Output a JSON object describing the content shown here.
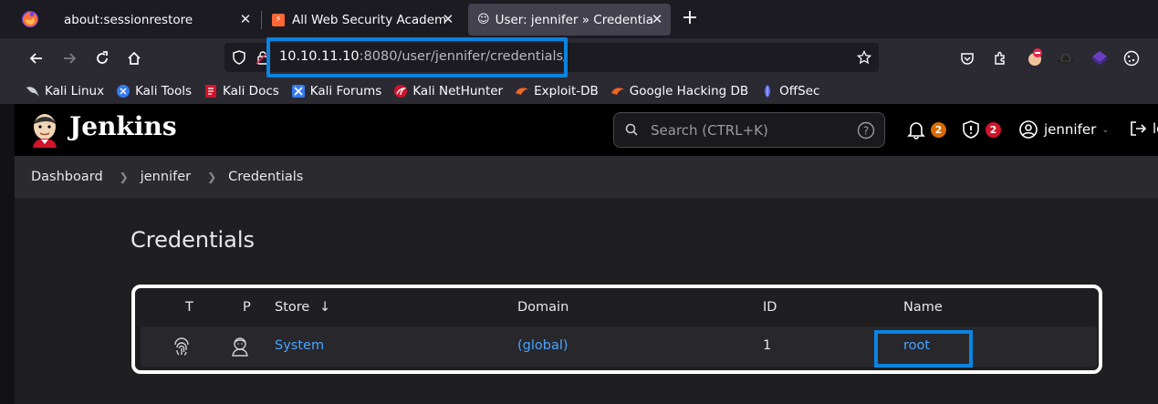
{
  "browser": {
    "tabs": [
      {
        "title": "about:sessionrestore"
      },
      {
        "title": "All Web Security Academy"
      },
      {
        "title": "User: jennifer » Credentials"
      }
    ],
    "url_host": "10.10.11.10",
    "url_rest": ":8080/user/jennifer/credentials/",
    "bookmarks": [
      {
        "label": "Kali Linux",
        "icon": "kali-dragon-icon"
      },
      {
        "label": "Kali Tools",
        "icon": "kali-tools-icon"
      },
      {
        "label": "Kali Docs",
        "icon": "kali-docs-icon"
      },
      {
        "label": "Kali Forums",
        "icon": "kali-forums-icon"
      },
      {
        "label": "Kali NetHunter",
        "icon": "nethunter-icon"
      },
      {
        "label": "Exploit-DB",
        "icon": "exploitdb-icon"
      },
      {
        "label": "Google Hacking DB",
        "icon": "ghdb-icon"
      },
      {
        "label": "OffSec",
        "icon": "offsec-icon"
      }
    ]
  },
  "jenkins": {
    "brand": "Jenkins",
    "search_placeholder": "Search (CTRL+K)",
    "notifications_count": "2",
    "security_count": "2",
    "username": "jennifer",
    "logout_label": "lo"
  },
  "breadcrumb": [
    "Dashboard",
    "jennifer",
    "Credentials"
  ],
  "page_title": "Credentials",
  "table": {
    "headers": {
      "t": "T",
      "p": "P",
      "store": "Store",
      "store_sort": "↓",
      "domain": "Domain",
      "id": "ID",
      "name": "Name"
    },
    "rows": [
      {
        "store": "System",
        "domain": "(global)",
        "id": "1",
        "name": "root"
      }
    ]
  },
  "colors": {
    "accent_link": "#4aa3ff",
    "highlight": "#0b84e0",
    "badge_orange": "#d96b00",
    "badge_red": "#d0142b"
  }
}
